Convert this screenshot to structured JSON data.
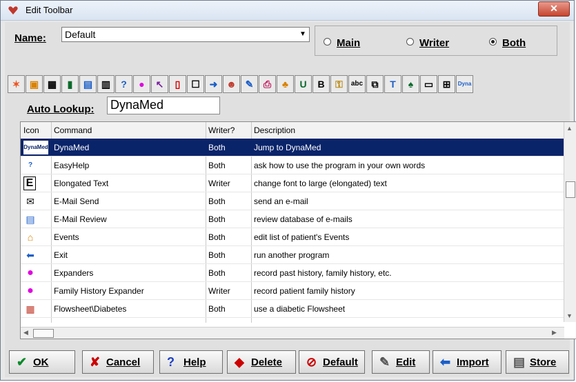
{
  "window": {
    "title": "Edit Toolbar"
  },
  "name": {
    "label": "Name:",
    "value": "Default"
  },
  "radios": [
    {
      "label": "Main",
      "selected": false
    },
    {
      "label": "Writer",
      "selected": false
    },
    {
      "label": "Both",
      "selected": true
    }
  ],
  "auto_lookup": {
    "label": "Auto Lookup:",
    "value": "DynaMed"
  },
  "table": {
    "headers": [
      "Icon",
      "Command",
      "Writer?",
      "Description"
    ],
    "rows": [
      {
        "command": "DynaMed",
        "writer": "Both",
        "description": "Jump to DynaMed",
        "selected": true
      },
      {
        "command": "EasyHelp",
        "writer": "Both",
        "description": "ask how to use the program in your own words"
      },
      {
        "command": "Elongated Text",
        "writer": "Writer",
        "description": "change font to large (elongated) text"
      },
      {
        "command": "E-Mail Send",
        "writer": "Both",
        "description": "send an e-mail"
      },
      {
        "command": "E-Mail Review",
        "writer": "Both",
        "description": "review database of e-mails"
      },
      {
        "command": "Events",
        "writer": "Both",
        "description": "edit list of patient's Events"
      },
      {
        "command": "Exit",
        "writer": "Both",
        "description": "run another program"
      },
      {
        "command": "Expanders",
        "writer": "Both",
        "description": "record past history, family history, etc."
      },
      {
        "command": "Family History Expander",
        "writer": "Writer",
        "description": "record patient family history"
      },
      {
        "command": "Flowsheet\\Diabetes",
        "writer": "Both",
        "description": "use a diabetic Flowsheet"
      }
    ]
  },
  "buttons": {
    "ok": "OK",
    "cancel": "Cancel",
    "help": "Help",
    "delete": "Delete",
    "default": "Default",
    "edit": "Edit",
    "import": "Import",
    "store": "Store"
  },
  "colors": {
    "selection": "#0a246a",
    "close": "#c5452f"
  }
}
